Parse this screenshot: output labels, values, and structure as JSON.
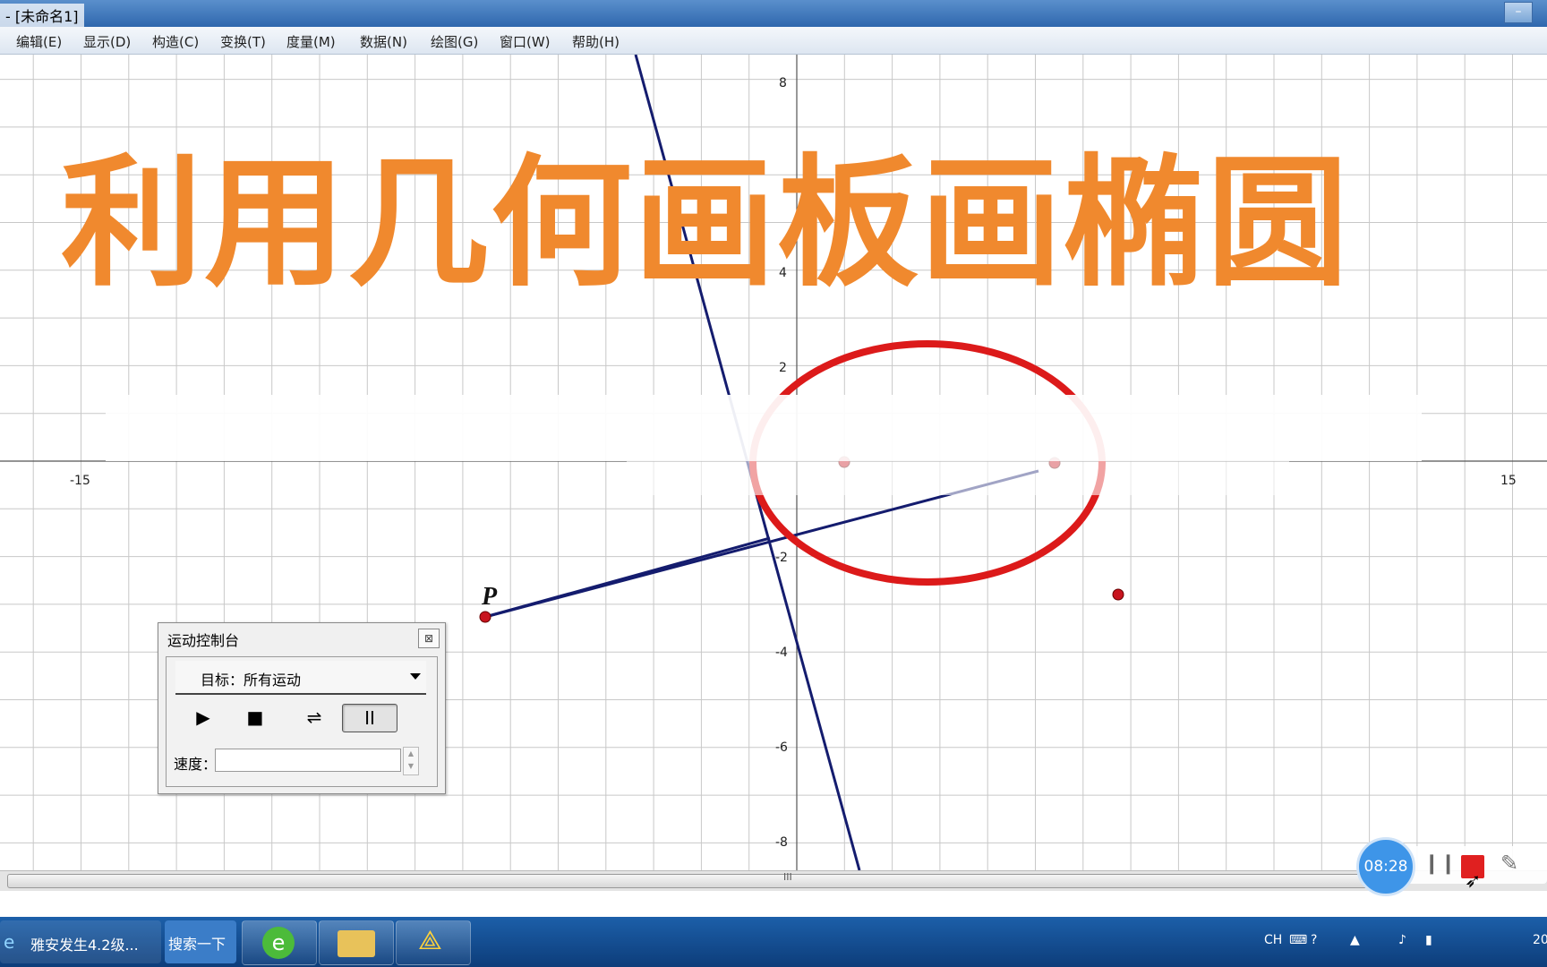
{
  "window": {
    "title": "- [未命名1]",
    "title_prefix": "",
    "min_label": "–"
  },
  "menu": [
    {
      "label": "编辑(E)"
    },
    {
      "label": "显示(D)"
    },
    {
      "label": "构造(C)"
    },
    {
      "label": "变换(T)"
    },
    {
      "label": "度量(M)"
    },
    {
      "label": "数据(N)"
    },
    {
      "label": "绘图(G)"
    },
    {
      "label": "窗口(W)"
    },
    {
      "label": "帮助(H)"
    }
  ],
  "canvas": {
    "headline": "利用几何画板画椭圆",
    "axis_x_ticks": [
      "-15",
      "15"
    ],
    "axis_y_ticks": [
      "8",
      "4",
      "2",
      "-2",
      "-4",
      "-6",
      "-8"
    ],
    "point_label": "P",
    "ellipse_color": "#dc1a1a",
    "line_color": "#141c6e"
  },
  "motion_panel": {
    "title": "运动控制台",
    "close_icon": "close-icon",
    "target_label": "目标：所有运动",
    "play_icon": "▶",
    "stop_icon": "■",
    "reverse_icon": "⇌",
    "pause_icon": "II",
    "speed_label": "速度："
  },
  "scrollbar": {
    "grip": "III"
  },
  "taskbar": {
    "ie_task": "雅安发生4.2级...",
    "search_button": "搜索一下",
    "tray_lang": "CH",
    "clock_fragment": "20"
  },
  "recorder": {
    "time": "08:28",
    "pause_icon": "❙❙",
    "stop_color": "#e02020"
  }
}
